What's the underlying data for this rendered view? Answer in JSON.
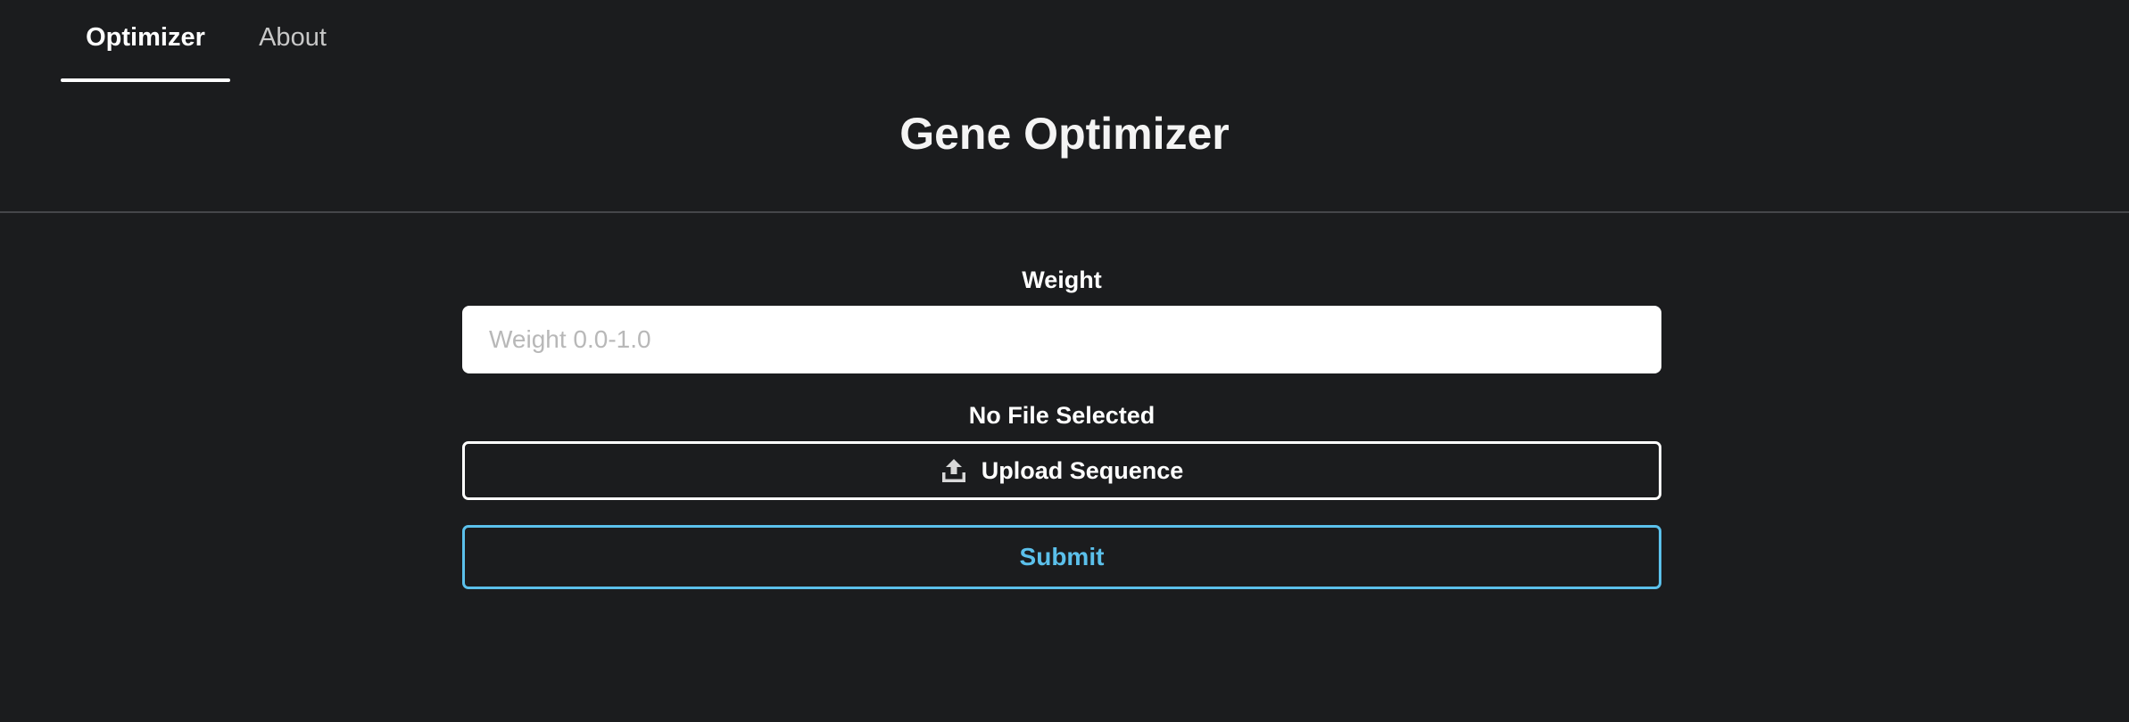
{
  "nav": {
    "tabs": [
      {
        "label": "Optimizer",
        "active": true
      },
      {
        "label": "About",
        "active": false
      }
    ]
  },
  "header": {
    "title": "Gene Optimizer"
  },
  "form": {
    "weight_label": "Weight",
    "weight_value": "",
    "weight_placeholder": "Weight 0.0-1.0",
    "file_status": "No File Selected",
    "upload_label": "Upload Sequence",
    "upload_icon": "upload-icon",
    "submit_label": "Submit"
  },
  "colors": {
    "background": "#1b1c1e",
    "accent": "#5bc0eb",
    "text": "#ffffff"
  }
}
